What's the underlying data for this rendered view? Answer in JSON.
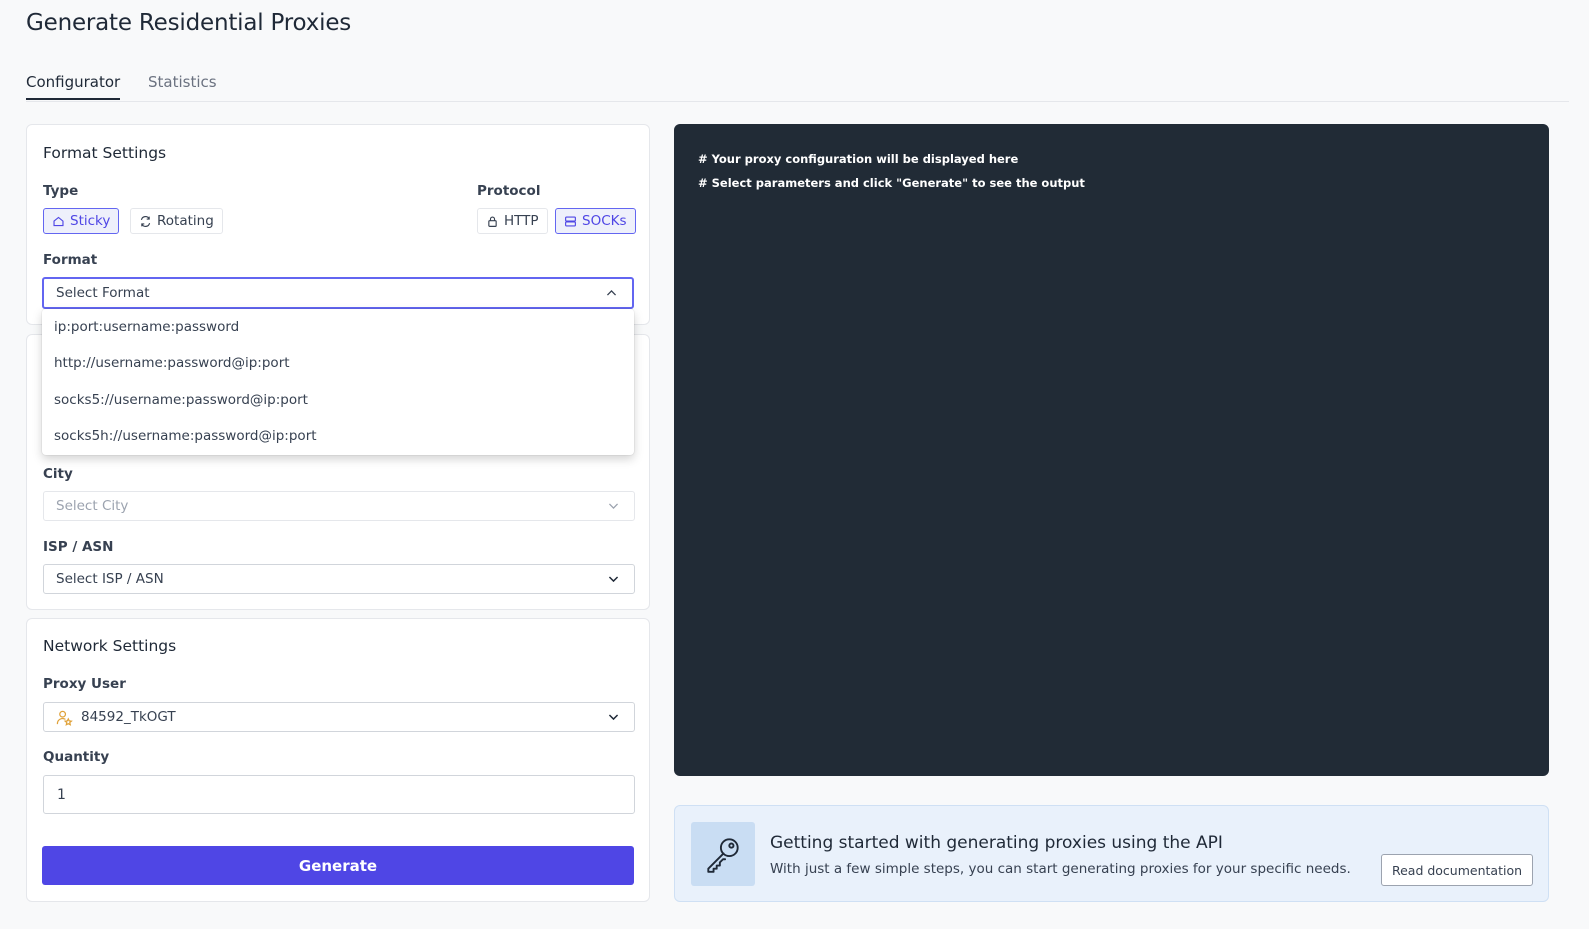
{
  "page": {
    "title": "Generate Residential Proxies"
  },
  "tabs": [
    {
      "label": "Configurator",
      "active": true
    },
    {
      "label": "Statistics",
      "active": false
    }
  ],
  "format_settings": {
    "title": "Format Settings",
    "type_label": "Type",
    "type_options": [
      {
        "label": "Sticky",
        "icon": "home-icon",
        "selected": true
      },
      {
        "label": "Rotating",
        "icon": "refresh-icon",
        "selected": false
      }
    ],
    "protocol_label": "Protocol",
    "protocol_options": [
      {
        "label": "HTTP",
        "icon": "lock-icon",
        "selected": false
      },
      {
        "label": "SOCKs",
        "icon": "server-icon",
        "selected": true
      }
    ],
    "format_label": "Format",
    "format_placeholder": "Select Format",
    "format_options": [
      "ip:port:username:password",
      "http://username:password@ip:port",
      "socks5://username:password@ip:port",
      "socks5h://username:password@ip:port"
    ]
  },
  "location": {
    "city_label": "City",
    "city_placeholder": "Select City",
    "isp_label": "ISP / ASN",
    "isp_placeholder": "Select ISP / ASN"
  },
  "network_settings": {
    "title": "Network Settings",
    "proxy_user_label": "Proxy User",
    "proxy_user_value": "84592_TkOGT",
    "quantity_label": "Quantity",
    "quantity_value": "1",
    "generate_label": "Generate"
  },
  "output": {
    "lines": [
      "# Your proxy configuration will be displayed here",
      "# Select parameters and click \"Generate\" to see the output"
    ]
  },
  "api_banner": {
    "title": "Getting started with generating proxies using the API",
    "subtitle": "With just a few simple steps, you can start generating proxies for your specific needs.",
    "button_label": "Read documentation"
  },
  "colors": {
    "accent": "#4f46e5",
    "code_bg": "#212b36",
    "banner_bg": "#e9f1fb"
  }
}
